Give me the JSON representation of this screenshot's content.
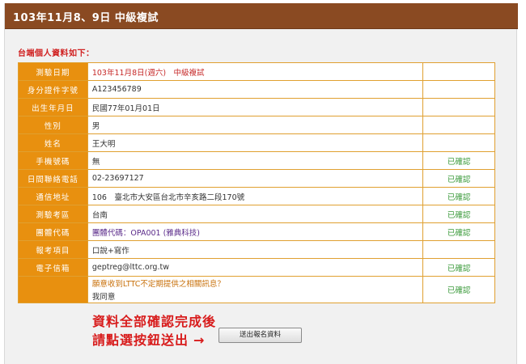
{
  "header": {
    "title": "103年11月8、9日 中級複試"
  },
  "section": {
    "label": "台端個人資料如下："
  },
  "rows": [
    {
      "label": "測驗日期",
      "value": "103年11月8日(週六)　中級複試",
      "status": ""
    },
    {
      "label": "身分證件字號",
      "value": "A123456789",
      "status": ""
    },
    {
      "label": "出生年月日",
      "value": "民國77年01月01日",
      "status": ""
    },
    {
      "label": "性別",
      "value": "男",
      "status": ""
    },
    {
      "label": "姓名",
      "value": "王大明",
      "status": ""
    },
    {
      "label": "手機號碼",
      "value": "無",
      "status": "已確認"
    },
    {
      "label": "日間聯絡電話",
      "value": "02-23697127",
      "status": "已確認"
    },
    {
      "label": "通信地址",
      "value": "106　臺北市大安區台北市辛亥路二段170號",
      "status": "已確認"
    },
    {
      "label": "測驗考區",
      "value": "台南",
      "status": "已確認"
    },
    {
      "label": "團體代碼",
      "value": "團體代碼：OPA001 (雅典科技)",
      "status": "已確認"
    },
    {
      "label": "報考項目",
      "value": "口說+寫作",
      "status": ""
    },
    {
      "label": "電子信箱",
      "value": "geptreg@lttc.org.tw",
      "status": "已確認"
    },
    {
      "label": "",
      "value": "願意收到LTTC不定期提供之相關訊息？",
      "value_line2": "我同意",
      "status": "已確認"
    }
  ],
  "notice": {
    "line1": "資料全部確認完成後",
    "line2": "請點選按鈕送出",
    "arrow": "→"
  },
  "submit": {
    "label": "送出報名資料"
  },
  "colors": {
    "header_bg": "#8a4a22",
    "label_bg": "#e8900f",
    "border": "#e0a030",
    "confirmed": "#3a9a3a",
    "notice": "#d81c1c"
  }
}
